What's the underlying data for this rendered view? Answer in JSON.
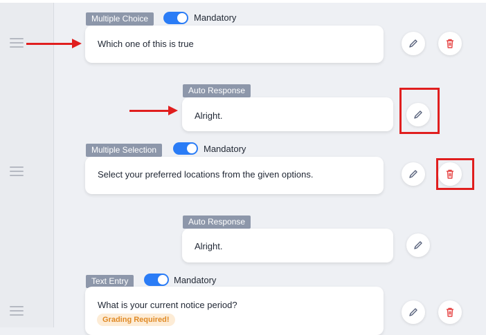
{
  "questions": [
    {
      "type_label": "Multiple Choice",
      "mandatory_label": "Mandatory",
      "mandatory_on": true,
      "text": "Which one of this is true"
    },
    {
      "type_label": "Multiple Selection",
      "mandatory_label": "Mandatory",
      "mandatory_on": true,
      "text": "Select your preferred locations from the given options."
    },
    {
      "type_label": "Text Entry",
      "mandatory_label": "Mandatory",
      "mandatory_on": true,
      "text": "What is your current notice period?",
      "badge": "Grading Required!"
    }
  ],
  "auto_responses": [
    {
      "label": "Auto Response",
      "text": "Alright."
    },
    {
      "label": "Auto Response",
      "text": "Alright."
    }
  ],
  "icons": {
    "edit": "pencil-icon",
    "delete": "trash-icon",
    "drag": "drag-handle-icon"
  },
  "colors": {
    "accent": "#2a7cf6",
    "chip": "#8d97aa",
    "delete": "#e64545",
    "annotation": "#e01e1e",
    "badge_bg": "#fdecd6",
    "badge_text": "#e08a25"
  }
}
